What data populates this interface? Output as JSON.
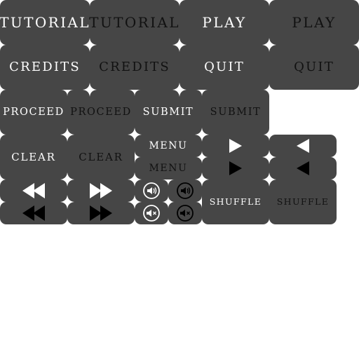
{
  "buttons": {
    "tutorial": "TUTORIAL",
    "play": "PLAY",
    "credits": "CREDITS",
    "quit": "QUIT",
    "proceed": "PROCEED",
    "submit": "SUBMIT",
    "clear": "CLEAR",
    "menu": "MENU",
    "shuffle": "SHUFFLE"
  },
  "icons": {
    "arrow_right": "play-triangle-right-icon",
    "arrow_left": "play-triangle-left-icon",
    "rewind": "rewind-icon",
    "fast_forward": "fast-forward-icon",
    "sound_on": "speaker-on-icon",
    "sound_off": "speaker-muted-icon"
  },
  "colors": {
    "button_face": "#464646",
    "label_normal": "#ffffff",
    "label_pressed": "#111111",
    "background": "#ffffff"
  }
}
